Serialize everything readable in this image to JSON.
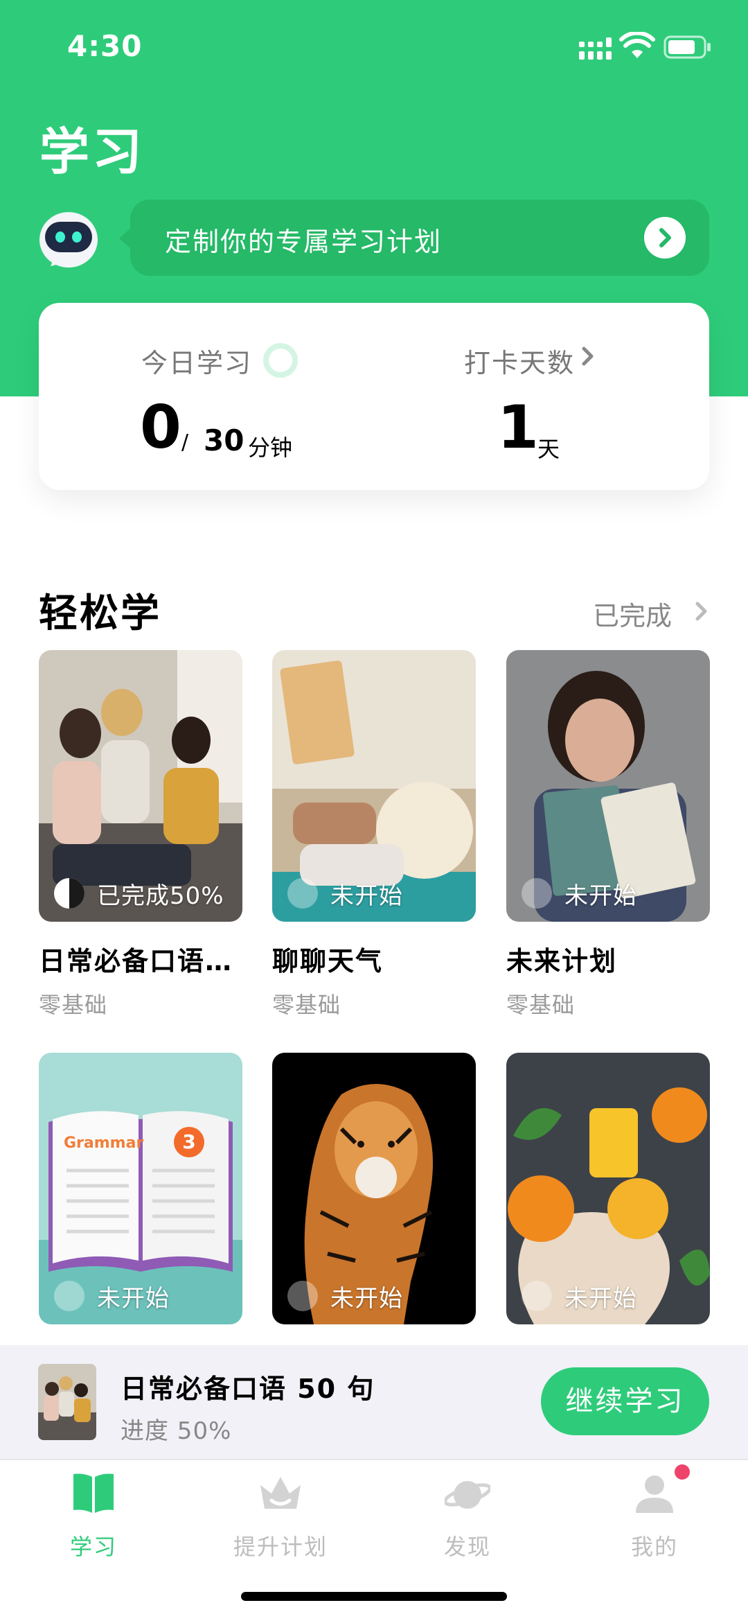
{
  "status_bar": {
    "time": "4:30"
  },
  "header": {
    "title": "学习",
    "plan_banner": "定制你的专属学习计划"
  },
  "stats": {
    "today_label": "今日学习",
    "today_value": "0",
    "today_separator": "/",
    "today_goal": "30",
    "today_unit": "分钟",
    "days_label": "打卡天数",
    "days_value": "1",
    "days_unit": "天"
  },
  "section": {
    "title": "轻松学",
    "completed_link": "已完成"
  },
  "courses": [
    {
      "title": "日常必备口语50句",
      "level": "零基础",
      "status": "已完成50%",
      "progress": 0.5
    },
    {
      "title": "聊聊天气",
      "level": "零基础",
      "status": "未开始",
      "progress": 0
    },
    {
      "title": "未来计划",
      "level": "零基础",
      "status": "未开始",
      "progress": 0
    },
    {
      "title": "",
      "level": "",
      "status": "未开始",
      "progress": 0,
      "cover_text": "Grammar",
      "cover_number": "3"
    },
    {
      "title": "",
      "level": "",
      "status": "未开始",
      "progress": 0
    },
    {
      "title": "",
      "level": "",
      "status": "未开始",
      "progress": 0
    }
  ],
  "continue_bar": {
    "title": "日常必备口语 50 句",
    "progress": "进度 50%",
    "button": "继续学习"
  },
  "tabs": [
    {
      "label": "学习",
      "icon": "book-icon",
      "active": true
    },
    {
      "label": "提升计划",
      "icon": "crown-icon",
      "active": false
    },
    {
      "label": "发现",
      "icon": "planet-icon",
      "active": false
    },
    {
      "label": "我的",
      "icon": "person-icon",
      "active": false
    }
  ],
  "colors": {
    "accent": "#2ecc7a",
    "notification": "#f0436b"
  }
}
